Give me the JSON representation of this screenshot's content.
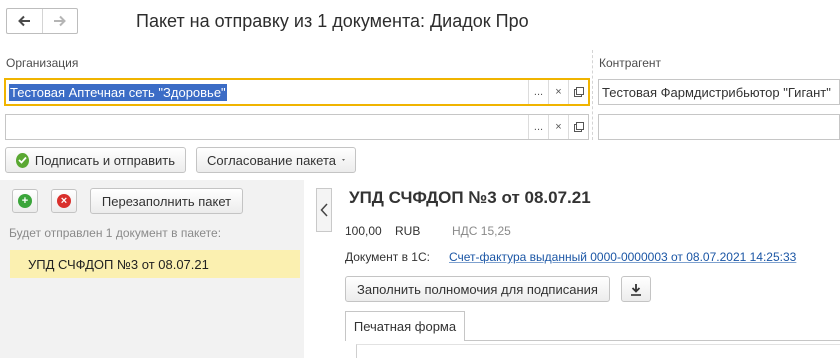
{
  "window": {
    "title": "Пакет на отправку из 1 документа: Диадок Про"
  },
  "nav": {
    "back_icon": "arrow-left-icon",
    "forward_icon": "arrow-right-icon"
  },
  "organization": {
    "label": "Организация",
    "value": "Тестовая Аптечная сеть \"Здоровье\"",
    "second_value": ""
  },
  "counterparty": {
    "label": "Контрагент",
    "value": "Тестовая Фармдистрибьютор \"Гигант\"",
    "second_value": ""
  },
  "field_buttons": {
    "more": "...",
    "clear": "×"
  },
  "toolbar": {
    "sign_send_label": "Подписать и отправить",
    "approval_label": "Согласование пакета"
  },
  "package": {
    "refill_label": "Перезаполнить пакет",
    "info_text": "Будет отправлен 1 документ в пакете:",
    "documents": [
      "УПД СЧФДОП №3 от 08.07.21"
    ]
  },
  "document": {
    "title": "УПД СЧФДОП №3 от 08.07.21",
    "amount": "100,00",
    "currency": "RUB",
    "vat": "НДС 15,25",
    "doc_1c_label": "Документ в 1С:",
    "doc_1c_link": "Счет-фактура выданный 0000-0000003 от 08.07.2021 14:25:33",
    "fill_authority_label": "Заполнить полномочия для подписания",
    "tab_label": "Печатная форма"
  },
  "colors": {
    "accent_focus": "#f0b400",
    "selection": "#3b6cc6",
    "link": "#1b56a5",
    "highlight_row": "#fbf0b0",
    "add_green": "#3aa53a",
    "delete_red": "#d9302c"
  }
}
